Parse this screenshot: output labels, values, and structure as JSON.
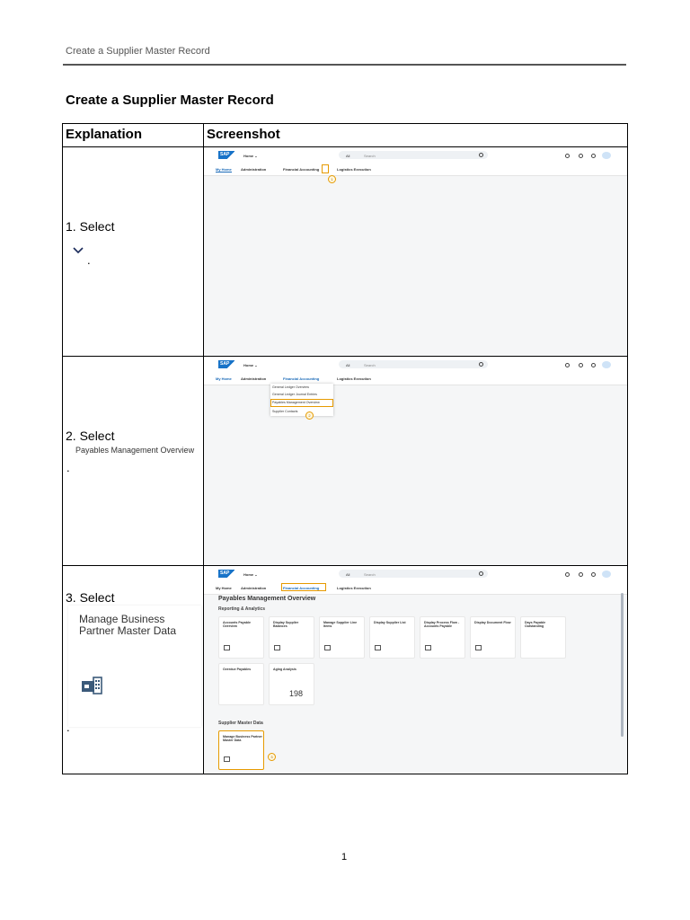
{
  "running_header": "Create a Supplier Master Record",
  "title": "Create a Supplier Master Record",
  "table": {
    "headers": [
      "Explanation",
      "Screenshot"
    ],
    "rows": [
      {
        "step": "1. Select",
        "icon": "chevron-down-icon",
        "suffix": "."
      },
      {
        "step": "2. Select",
        "item_label": "Payables Management Overview",
        "suffix": "."
      },
      {
        "step": "3. Select",
        "item_label": "Manage Business Partner Master Data",
        "icon": "business-partner-tile-icon",
        "suffix": "."
      }
    ]
  },
  "shots": {
    "logo": "SAP",
    "home": "Home ⌄",
    "search_scope": "All",
    "search_placeholder": "Search",
    "avatar": "CC",
    "nav": {
      "my_home": "My Home",
      "administration": "Administration",
      "financial_accounting": "Financial Accounting",
      "logistics_execution": "Logistics Execution"
    },
    "dropdown": [
      "General Ledger Overview",
      "General Ledger Journal Entries",
      "Payables Management Overview",
      "Supplier Contacts"
    ],
    "panel_title": "Payables Management Overview",
    "section_reporting": "Reporting & Analytics",
    "tiles_row1": [
      "Accounts Payable Overview",
      "Display Supplier Balances",
      "Manage Supplier Line Items",
      "Display Supplier List",
      "Display Process Flow - Accounts Payable",
      "Display Document Flow",
      "Days Payable Outstanding"
    ],
    "tiles_row2": [
      "Overdue Payables",
      "Aging Analysis"
    ],
    "aging_value": "198",
    "section_supplier": "Supplier Master Data",
    "supplier_tile": "Manage Business Partner Master Data",
    "markers": [
      "1",
      "2",
      "3"
    ]
  },
  "page_number": "1"
}
